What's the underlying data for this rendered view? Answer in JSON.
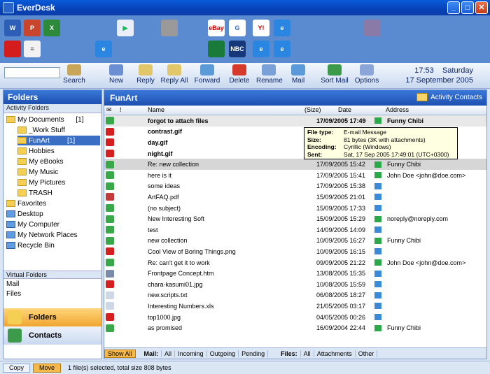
{
  "app": {
    "title": "EverDesk"
  },
  "toolbar": {
    "search": "Search",
    "new": "New",
    "reply": "Reply",
    "reply_all": "Reply All",
    "forward": "Forward",
    "delete": "Delete",
    "rename": "Rename",
    "mail": "Mail",
    "sort_mail": "Sort Mail",
    "options": "Options",
    "time": "17:53",
    "day": "Saturday",
    "date": "17 September 2005"
  },
  "left": {
    "title": "Folders",
    "section": "Activity Folders",
    "tree": [
      {
        "label": "My Documents",
        "count": "[1]"
      },
      {
        "label": "_Work Stuff",
        "count": ""
      },
      {
        "label": "FunArt",
        "count": "[1]"
      },
      {
        "label": "Hobbies",
        "count": ""
      },
      {
        "label": "My eBooks",
        "count": ""
      },
      {
        "label": "My Music",
        "count": ""
      },
      {
        "label": "My Pictures",
        "count": ""
      },
      {
        "label": "TRASH",
        "count": ""
      },
      {
        "label": "Favorites",
        "count": ""
      },
      {
        "label": "Desktop",
        "count": ""
      },
      {
        "label": "My Computer",
        "count": ""
      },
      {
        "label": "My Network Places",
        "count": ""
      },
      {
        "label": "Recycle Bin",
        "count": ""
      }
    ],
    "virtual_title": "Virtual Folders",
    "virtual": [
      "Mail",
      "Files"
    ],
    "nav_folders": "Folders",
    "nav_contacts": "Contacts"
  },
  "main": {
    "title": "FunArt",
    "activity_contacts": "Activity Contacts",
    "col_name": "Name",
    "col_size": "(Size)",
    "col_date": "Date",
    "col_address": "Address",
    "rows": [
      {
        "name": "forgot to attach files",
        "date": "17/09/2005 17:49",
        "addr": "Funny Chibi"
      },
      {
        "name": "contrast.gif",
        "date": "",
        "addr": ""
      },
      {
        "name": "day.gif",
        "date": "",
        "addr": ""
      },
      {
        "name": "night.gif",
        "date": "",
        "addr": ""
      },
      {
        "name": "Re: new collection",
        "date": "17/09/2005 15:42",
        "addr": "Funny Chibi"
      },
      {
        "name": "here is it",
        "date": "17/09/2005 15:41",
        "addr": "John Doe <john@doe.com>"
      },
      {
        "name": "some ideas",
        "date": "17/09/2005 15:38",
        "addr": ""
      },
      {
        "name": "ArtFAQ.pdf",
        "date": "15/09/2005 21:01",
        "addr": ""
      },
      {
        "name": "(no subject)",
        "date": "15/09/2005 17:33",
        "addr": ""
      },
      {
        "name": "New Interesting Soft",
        "date": "15/09/2005 15:29",
        "addr": "noreply@noreply.com"
      },
      {
        "name": "test",
        "date": "14/09/2005 14:09",
        "addr": ""
      },
      {
        "name": "new collection",
        "date": "10/09/2005 16:27",
        "addr": "Funny Chibi"
      },
      {
        "name": "Cool View of Boring Things.png",
        "date": "10/09/2005 16:15",
        "addr": ""
      },
      {
        "name": "Re: can't get it to work",
        "date": "09/09/2005 21:22",
        "addr": "John Doe <john@doe.com>"
      },
      {
        "name": "Frontpage Concept.htm",
        "date": "13/08/2005 15:35",
        "addr": ""
      },
      {
        "name": "chara-kasumi01.jpg",
        "date": "10/08/2005 15:59",
        "addr": ""
      },
      {
        "name": "new.scripts.txt",
        "date": "06/08/2005 18:27",
        "addr": ""
      },
      {
        "name": "Interesting Numbers.xls",
        "date": "21/05/2005 03:17",
        "addr": ""
      },
      {
        "name": "top1000.jpg",
        "date": "04/05/2005 00:26",
        "addr": ""
      },
      {
        "name": "as promised",
        "date": "16/09/2004 22:44",
        "addr": "Funny Chibi"
      }
    ],
    "tooltip": {
      "k1": "File type:",
      "v1": "E-mail Message",
      "k2": "Size:",
      "v2": "81 bytes (3K with attachments)",
      "k3": "Encoding:",
      "v3": "Cyrillic (Windows)",
      "k4": "Sent:",
      "v4": "Sat, 17 Sep 2005 17:49:01 (UTC+0300)"
    },
    "filters": {
      "show_all": "Show All",
      "mail": "Mail:",
      "all": "All",
      "incoming": "Incoming",
      "outgoing": "Outgoing",
      "pending": "Pending",
      "files": "Files:",
      "files_all": "All",
      "attachments": "Attachments",
      "other": "Other"
    }
  },
  "status": {
    "copy": "Copy",
    "move": "Move",
    "text": "1 file(s) selected, total size 808 bytes"
  }
}
